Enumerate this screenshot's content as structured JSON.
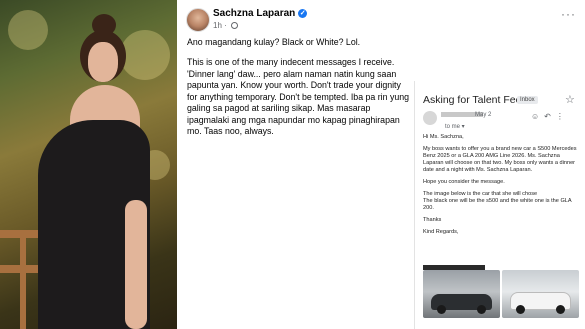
{
  "post": {
    "author": "Sachzna Laparan",
    "time": "1h",
    "caption": "Ano magandang kulay? Black or White? Lol.",
    "body": "This is one of the many indecent messages I receive. 'Dinner lang' daw... pero alam naman natin kung saan papunta yan. Know your worth. Don't trade your dignity for anything temporary. Don't be tempted. Iba pa rin yung galing sa pagod at sariling sikap. Mas masarap ipagmalaki ang mga napundar mo kapag pinaghirapan mo. Taas noo, always."
  },
  "email": {
    "subject": "Asking for Talent Fee",
    "label": "Inbox",
    "date": "May 2",
    "to": "to me",
    "greeting": "Hi Ms. Sachzna,",
    "paragraph1": "My boss wants to offer you a brand new car a S500 Mercedes Benz 2025 or a GLA 200 AMG Line 2026. Ms. Sachzna Laparan will choose on that two. My boss only wants a dinner date and a night with Ms. Sachzna Laparan.",
    "paragraph2": "Hope you consider the message.",
    "paragraph3a": "The image below is the car that she will chose",
    "paragraph3b": "The black one will be the s500 and the white one is the GLA 200.",
    "thanks": "Thanks",
    "regards": "Kind Regards,"
  },
  "icons": {
    "verified": "verified-badge-icon",
    "globe": "globe-icon",
    "more": "more-options-icon",
    "star": "star-icon",
    "emoji": "emoji-icon",
    "reply": "reply-icon",
    "menu": "more-vert-icon"
  },
  "colors": {
    "verified": "#1877f2",
    "text": "#050505",
    "muted": "#65676b"
  }
}
